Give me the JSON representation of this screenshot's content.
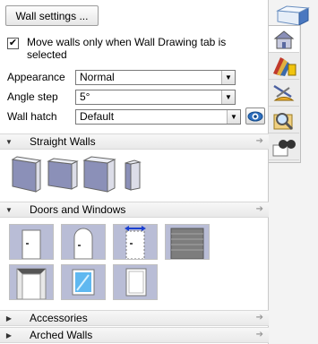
{
  "header": {
    "settings_button": "Wall settings ..."
  },
  "option": {
    "move_walls_label": "Move walls only when Wall Drawing tab is selected",
    "checked": true
  },
  "fields": {
    "appearance": {
      "label": "Appearance",
      "value": "Normal"
    },
    "angle_step": {
      "label": "Angle step",
      "value": "5°"
    },
    "wall_hatch": {
      "label": "Wall hatch",
      "value": "Default"
    }
  },
  "sections": {
    "straight_walls": {
      "title": "Straight Walls",
      "expanded": true
    },
    "doors_windows": {
      "title": "Doors and Windows",
      "expanded": true
    },
    "accessories": {
      "title": "Accessories",
      "expanded": false
    },
    "arched_walls": {
      "title": "Arched Walls",
      "expanded": false
    }
  },
  "icons": {
    "sidetabs": [
      "house-icon",
      "materials-palette-icon",
      "measure-tools-icon",
      "search-map-icon",
      "binoculars-book-icon"
    ],
    "top": "wall-panel-icon"
  },
  "colors": {
    "tile_bg": "#b9bdd6",
    "wall_face": "#8b90b8",
    "section_bg": "#ededed"
  }
}
